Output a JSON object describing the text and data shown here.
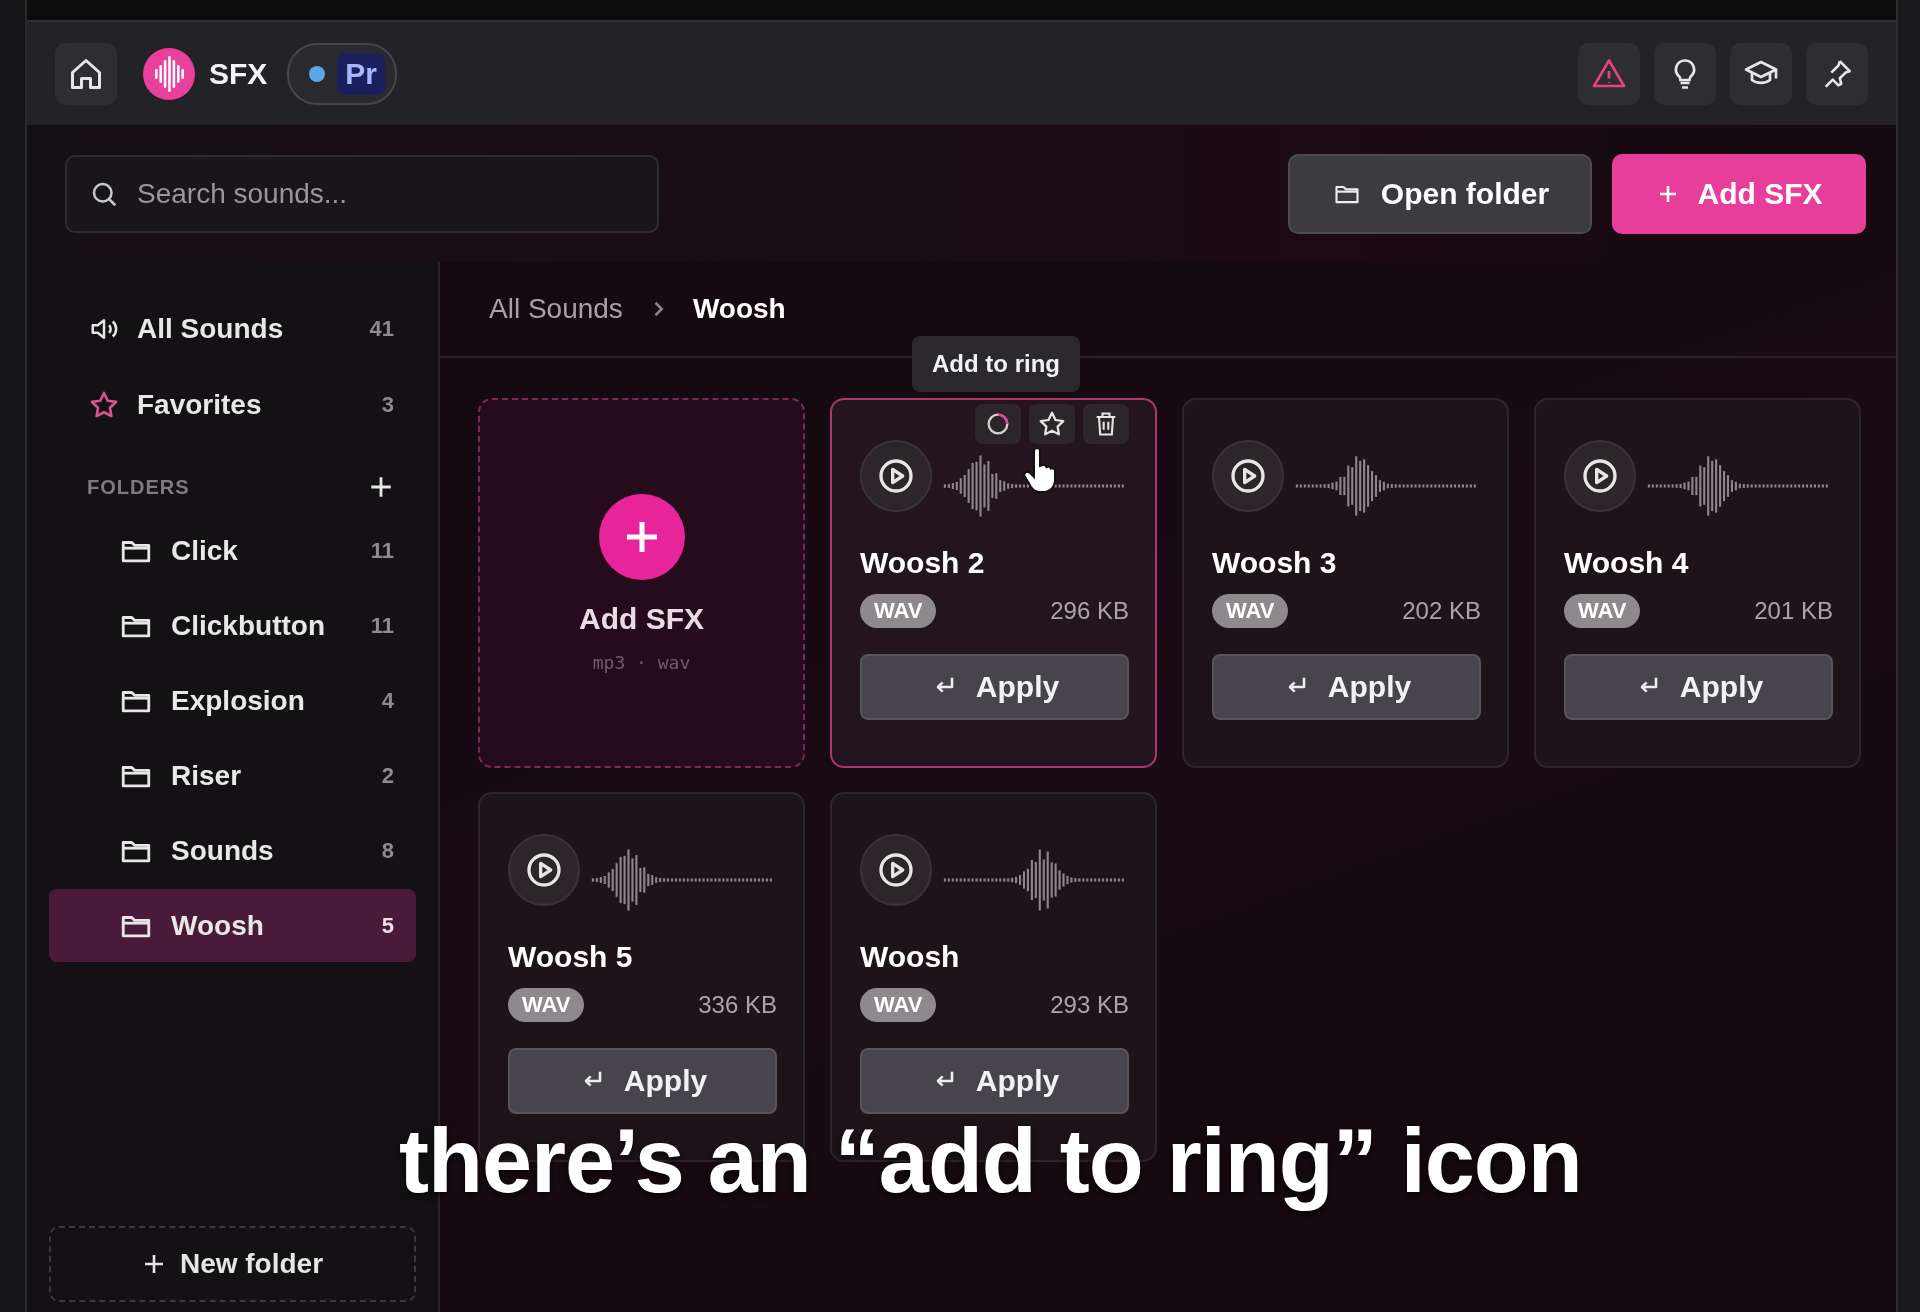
{
  "topbar": {
    "app_name": "SFX",
    "host_badge": "Pr"
  },
  "toolbar": {
    "search": {
      "placeholder": "Search sounds..."
    },
    "buttons": [
      {
        "label": "Open folder",
        "kind": "secondary"
      },
      {
        "label": "Add SFX",
        "kind": "primary"
      }
    ]
  },
  "sidebar": {
    "items": [
      {
        "kind": "speaker",
        "label": "All Sounds",
        "count": "41",
        "selected": false
      },
      {
        "kind": "star",
        "label": "Favorites",
        "count": "3",
        "selected": false
      }
    ],
    "folders_heading": "FOLDERS",
    "folders": [
      {
        "label": "Click",
        "count": "11",
        "selected": false
      },
      {
        "label": "Clickbutton",
        "count": "11",
        "selected": false
      },
      {
        "label": "Explosion",
        "count": "4",
        "selected": false
      },
      {
        "label": "Riser",
        "count": "2",
        "selected": false
      },
      {
        "label": "Sounds",
        "count": "8",
        "selected": false
      },
      {
        "label": "Woosh",
        "count": "5",
        "selected": true
      }
    ],
    "new_folder": "New folder"
  },
  "breadcrumb": [
    "All Sounds",
    "Woosh"
  ],
  "cards": [
    {
      "kind": "add",
      "title": "Add SFX",
      "formats": "mp3 · wav"
    },
    {
      "kind": "sound",
      "title": "Woosh 2",
      "format": "WAV",
      "size": "296 KB",
      "action": "Apply",
      "selected": true,
      "tooltip": "Add to ring"
    },
    {
      "kind": "sound",
      "title": "Woosh 3",
      "format": "WAV",
      "size": "202 KB",
      "action": "Apply",
      "selected": false
    },
    {
      "kind": "sound",
      "title": "Woosh 4",
      "format": "WAV",
      "size": "201 KB",
      "action": "Apply",
      "selected": false
    },
    {
      "kind": "sound",
      "title": "Woosh 5",
      "format": "WAV",
      "size": "336 KB",
      "action": "Apply",
      "selected": false
    },
    {
      "kind": "sound",
      "title": "Woosh",
      "format": "WAV",
      "size": "293 KB",
      "action": "Apply",
      "selected": false
    }
  ],
  "caption": "there’s an “add to ring” icon"
}
